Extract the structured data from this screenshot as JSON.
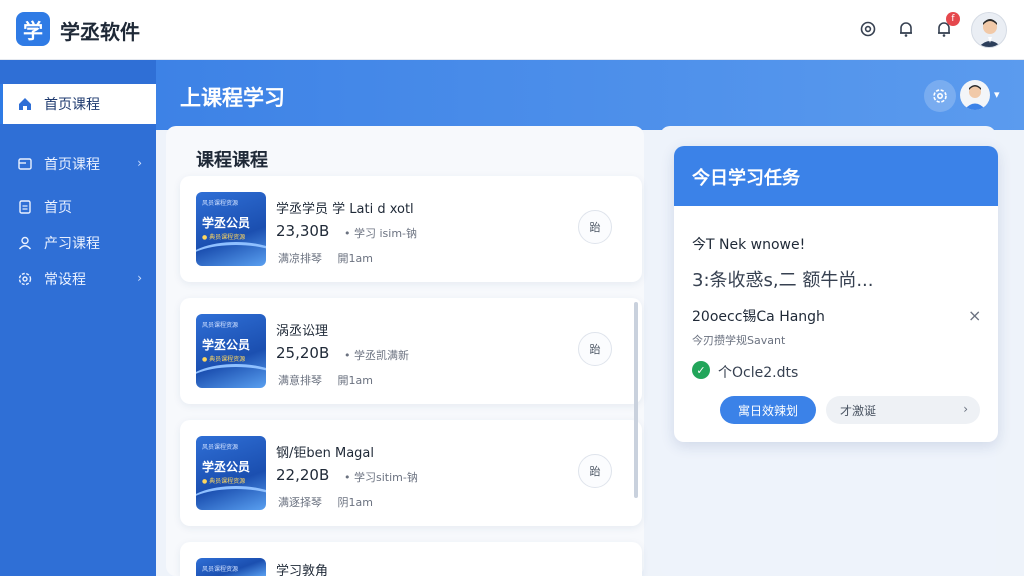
{
  "app": {
    "logo_char": "学",
    "title": "学丞软件",
    "notification_count": "f"
  },
  "sidebar": {
    "items": [
      {
        "label": "首页课程",
        "icon": "home-icon",
        "active": true
      },
      {
        "label": "首页课程",
        "icon": "book-icon",
        "chevron": "›"
      },
      {
        "label": "首页",
        "icon": "document-icon"
      },
      {
        "label": "产习课程",
        "icon": "user-icon"
      },
      {
        "label": "常设程",
        "icon": "gear-icon",
        "chevron": "›"
      }
    ]
  },
  "header": {
    "title": "上课程学习"
  },
  "courses": {
    "heading": "课程课程",
    "items": [
      {
        "title": "学丞学员 学 Lati d xotl",
        "count": "23,30B",
        "meta": "学习 isim-钠",
        "tags": [
          "满凉排琴",
          "開1am"
        ],
        "button": "跆",
        "thumb": {
          "top": "风员课程资源",
          "main": "学丞公员",
          "sub": "● 典员课程资源"
        }
      },
      {
        "title": "涡丞讼理",
        "count": "25,20B",
        "meta": "学丞凯满新",
        "tags": [
          "满意排琴",
          "開1am"
        ],
        "button": "跆",
        "thumb": {
          "top": "风员课程资源",
          "main": "学丞公员",
          "sub": "● 典员课程资源"
        }
      },
      {
        "title": "钢/钜ben Magal",
        "count": "22,20B",
        "meta": "学习sitim-钠",
        "tags": [
          "满逐择琴",
          "阴1am"
        ],
        "button": "跆",
        "thumb": {
          "top": "风员课程资源",
          "main": "学丞公员",
          "sub": "● 典员课程资源"
        }
      },
      {
        "title": "学习敦角",
        "count": "",
        "meta": "",
        "tags": [],
        "button": "",
        "thumb": {
          "top": "风员课程资源",
          "main": "",
          "sub": ""
        }
      }
    ]
  },
  "tasks": {
    "title": "今日学习任务",
    "line1": "今T Nek wnowe!",
    "line2": "3:条收惑s,二 额牛尚...",
    "line3": "20oecc锡Ca Hangh",
    "line4": "今刃攒学规Savant",
    "line5": "个Ocle2.dts",
    "primary_button": "寓日效辣划",
    "secondary_button": "才激诞",
    "close": "×",
    "check": "✓"
  }
}
